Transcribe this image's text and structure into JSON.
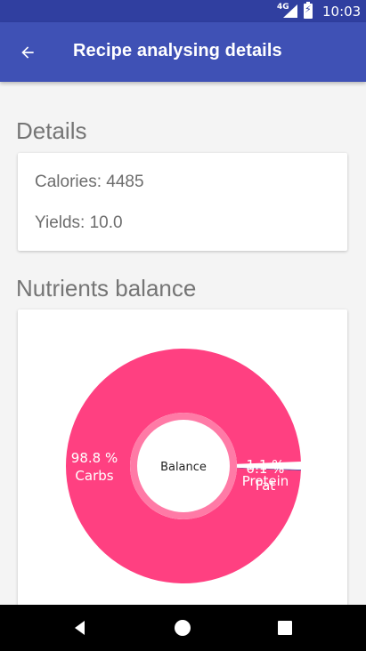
{
  "status_bar": {
    "network": "4G",
    "battery_glyph": "⚡",
    "time": "10:03",
    "color": "#303fa0"
  },
  "app_bar": {
    "title": "Recipe analysing details",
    "back_icon": "arrow-left",
    "color": "#3f51b5"
  },
  "details": {
    "section_title": "Details",
    "calories": "Calories: 4485",
    "yields": "Yields: 10.0"
  },
  "nutrients": {
    "section_title": "Nutrients balance"
  },
  "chart_data": {
    "type": "pie",
    "center_text": "Balance",
    "slices": [
      {
        "name": "Carbs",
        "value": 98.8,
        "label": "98.8 %",
        "color": "#ff4081"
      },
      {
        "name": "Protein",
        "value": 1.1,
        "label": "1.1 %",
        "color": "#ffffff"
      },
      {
        "name": "Fat",
        "value": 0.1,
        "label": "0.1 %",
        "color": "#303f9f"
      }
    ]
  },
  "nav_bar": {
    "buttons": [
      "back",
      "home",
      "recents"
    ]
  }
}
